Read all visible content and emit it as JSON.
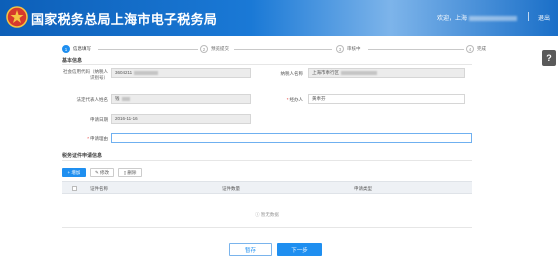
{
  "header": {
    "title": "国家税务总局上海市电子税务局",
    "user_prefix": "欢迎，上海",
    "logout": "退出"
  },
  "help": {
    "label": "?"
  },
  "steps": [
    {
      "num": "1",
      "label": "信息填写"
    },
    {
      "num": "2",
      "label": "预览提交"
    },
    {
      "num": "3",
      "label": "审核中"
    },
    {
      "num": "4",
      "label": "完成"
    }
  ],
  "basic": {
    "section_title": "基本信息",
    "tax_id_label": "社会信用代码（纳税人识别号）",
    "tax_id_value": "3604211",
    "taxpayer_name_label": "纳税人名称",
    "taxpayer_name_value": "上海市奉行区",
    "legal_rep_label": "法定代表人姓名",
    "legal_rep_value": "钱",
    "operator_label": "经办人",
    "operator_value": "黄奉芬",
    "date_label": "申请日期",
    "date_value": "2016-11-16",
    "reason_label": "申请理由",
    "reason_value": ""
  },
  "cert": {
    "section_title": "税务证件申请信息",
    "add_label": "+ 增加",
    "edit_label": "修改",
    "delete_label": "删除",
    "columns": [
      "证件名称",
      "证件数量",
      "申请类型"
    ],
    "empty_text": "暂无数据"
  },
  "footer": {
    "save_label": "暂存",
    "next_label": "下一步"
  },
  "colors": {
    "brand_blue": "#1a79d6",
    "primary": "#1f8ff0",
    "required": "#e53935"
  }
}
